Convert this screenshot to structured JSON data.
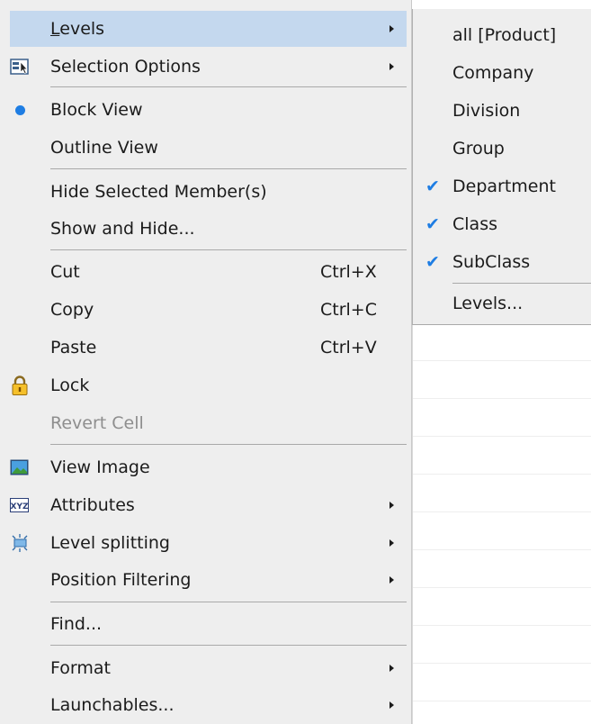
{
  "main_menu": {
    "levels": "Levels",
    "selection_options": "Selection Options",
    "block_view": "Block View",
    "outline_view": "Outline View",
    "hide_selected": "Hide Selected Member(s)",
    "show_and_hide": "Show and Hide...",
    "cut": "Cut",
    "cut_shortcut": "Ctrl+X",
    "copy": "Copy",
    "copy_shortcut": "Ctrl+C",
    "paste": "Paste",
    "paste_shortcut": "Ctrl+V",
    "lock": "Lock",
    "revert_cell": "Revert Cell",
    "view_image": "View Image",
    "attributes": "Attributes",
    "level_splitting": "Level splitting",
    "position_filtering": "Position Filtering",
    "find": "Find...",
    "format": "Format",
    "launchables": "Launchables..."
  },
  "levels_submenu": {
    "items": [
      {
        "label": "all [Product]",
        "checked": false
      },
      {
        "label": "Company",
        "checked": false
      },
      {
        "label": "Division",
        "checked": false
      },
      {
        "label": "Group",
        "checked": false
      },
      {
        "label": "Department",
        "checked": true
      },
      {
        "label": "Class",
        "checked": true
      },
      {
        "label": "SubClass",
        "checked": true
      }
    ],
    "levels_dialog": "Levels..."
  },
  "colors": {
    "menu_bg": "#eeeeee",
    "highlight": "#c4d8ee",
    "accent": "#1e7de3",
    "disabled_text": "#8e8e8e"
  }
}
